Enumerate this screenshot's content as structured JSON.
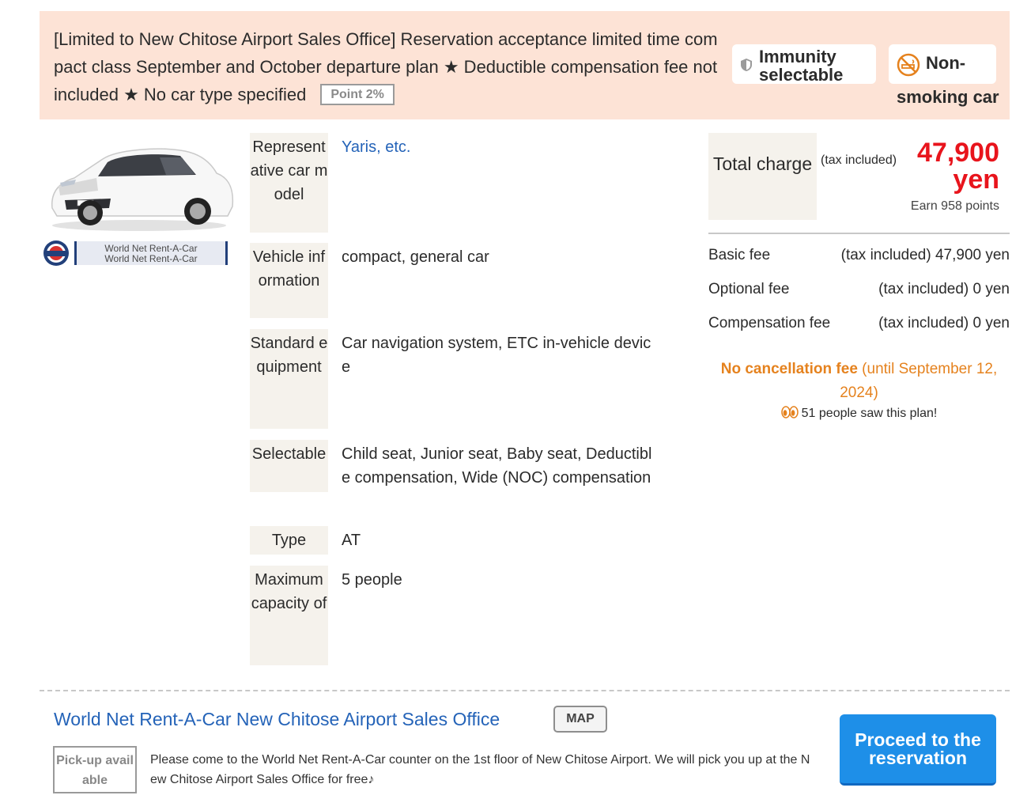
{
  "plan": {
    "title": "[Limited to New Chitose Airport Sales Office] Reservation acceptance limited time compact class September and October departure plan ★ Deductible compensation fee not included ★ No car type specified",
    "point_badge": "Point 2%",
    "tags": {
      "immunity": "Immunity selectable",
      "non_smoking_line1": "Non-",
      "non_smoking_rest": "smoking car"
    }
  },
  "company": {
    "logo_line1": "World Net Rent-A-Car",
    "logo_line2": "World Net Rent-A-Car"
  },
  "specs": {
    "car_model_label": "Representative car model",
    "car_model_value": "Yaris, etc.",
    "vehicle_info_label": "Vehicle information",
    "vehicle_info_value": "compact, general car",
    "equipment_label": "Standard equipment",
    "equipment_value": "Car navigation system, ETC in-vehicle device",
    "selectable_label": "Selectable",
    "selectable_value": "Child seat, Junior seat, Baby seat, Deductible compensation, Wide (NOC) compensation",
    "type_label": "Type",
    "type_value": "AT",
    "capacity_label": "Maximum capacity of",
    "capacity_value": "5 people"
  },
  "pricing": {
    "total_label": "Total charge",
    "tax_note": "(tax included)",
    "total_amount": "47,900",
    "total_unit": "yen",
    "points_earned": "Earn 958 points",
    "fees": [
      {
        "label": "Basic fee",
        "value": "(tax included) 47,900 yen"
      },
      {
        "label": "Optional fee",
        "value": "(tax included) 0 yen"
      },
      {
        "label": "Compensation fee",
        "value": "(tax included) 0 yen"
      }
    ],
    "cancellation_bold": "No cancellation fee",
    "cancellation_until": " (until September 12, 2024)",
    "views_text": "51 people saw this plan!"
  },
  "office": {
    "name": "World Net Rent-A-Car New Chitose Airport Sales Office",
    "map_label": "MAP",
    "pickup_badge": "Pick-up available",
    "pickup_text": "Please come to the World Net Rent-A-Car counter on the 1st floor of New Chitose Airport. We will pick you up at the New Chitose Airport Sales Office for free♪"
  },
  "actions": {
    "proceed_label": "Proceed to the reservation"
  },
  "colors": {
    "header_bg": "#fde3d6",
    "price_red": "#e8141c",
    "link_blue": "#2463b8",
    "cancel_orange": "#e5821e",
    "button_blue": "#1e8fe8"
  }
}
